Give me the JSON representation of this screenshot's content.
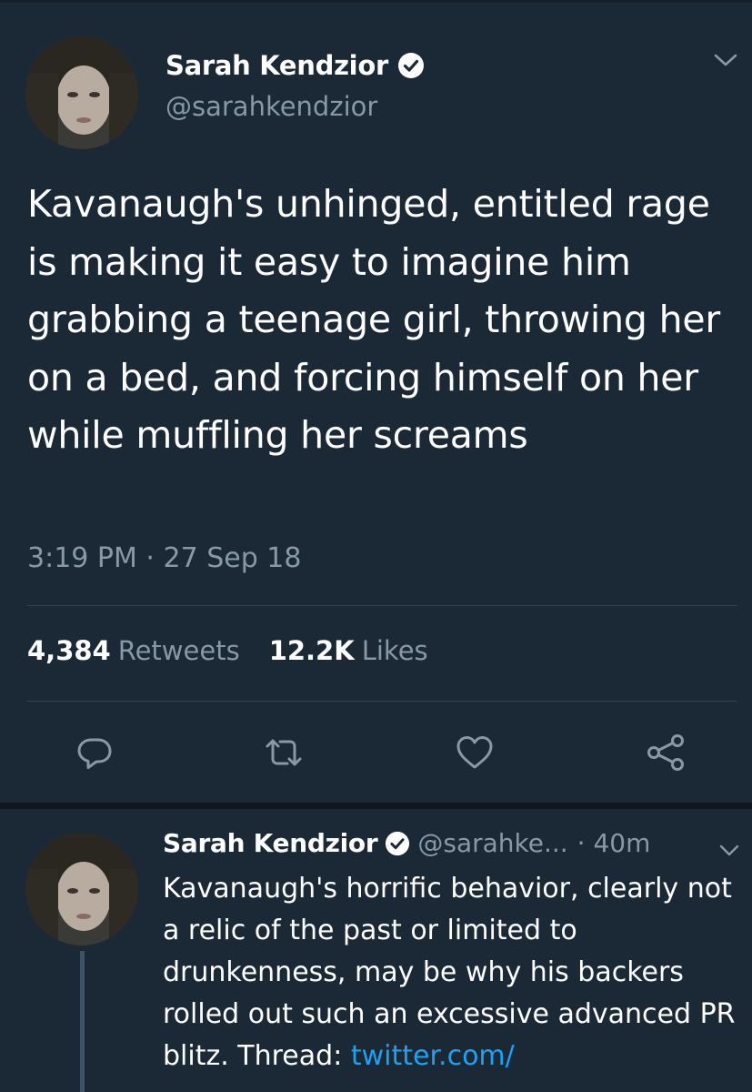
{
  "tweet": {
    "author_name": "Sarah Kendzior",
    "author_handle": "@sarahkendzior",
    "text": "Kavanaugh's unhinged, entitled rage is making it easy to imagine him grabbing a teenage girl, throwing her on a bed, and forcing himself on her while muffling her screams",
    "timestamp": "3:19 PM · 27 Sep 18",
    "retweets_count": "4,384",
    "retweets_label": "Retweets",
    "likes_count": "12.2K",
    "likes_label": "Likes",
    "verified": true
  },
  "actions": {
    "reply_icon": "reply-icon",
    "retweet_icon": "retweet-icon",
    "like_icon": "heart-icon",
    "share_icon": "share-icon"
  },
  "reply": {
    "author_name": "Sarah Kendzior",
    "author_handle": "@sarahke...",
    "time": "· 40m",
    "text": "Kavanaugh's horrific behavior, clearly not a relic of the past or limited to drunkenness, may be why his backers rolled out such an excessive advanced PR blitz. Thread: ",
    "link_text": "twitter.com/",
    "verified": true
  },
  "colors": {
    "background": "#1b2836",
    "secondary_text": "#8899a6",
    "link": "#1da1f2",
    "divider": "#38444d"
  }
}
